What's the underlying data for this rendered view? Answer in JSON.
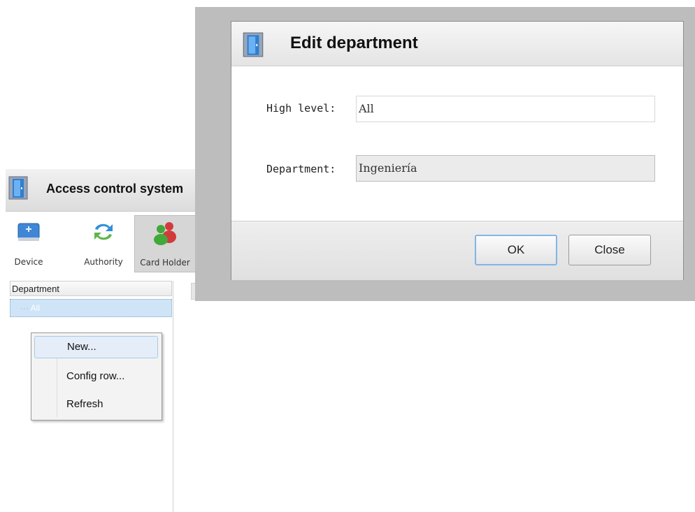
{
  "app": {
    "title": "Access control system",
    "toolbar": [
      {
        "label": "Device",
        "icon": "device-icon"
      },
      {
        "label": "Authority",
        "icon": "authority-sync-icon"
      },
      {
        "label": "Card Holder",
        "icon": "card-holder-icon",
        "active": true
      }
    ],
    "department_header": "Department",
    "tree": [
      {
        "label": "All",
        "selected": true
      }
    ]
  },
  "context_menu": {
    "items": [
      "New...",
      "Config row...",
      "Refresh"
    ],
    "hovered": "New..."
  },
  "dialog": {
    "title": "Edit department",
    "high_level_label": "High level:",
    "high_level_value": "All",
    "department_label": "Department:",
    "department_value": "Ingeniería",
    "ok_label": "OK",
    "close_label": "Close"
  },
  "colors": {
    "selection": "#cfe4f7",
    "default_button_border": "#7fb6e6",
    "dialog_frame": "#bdbdbd"
  }
}
